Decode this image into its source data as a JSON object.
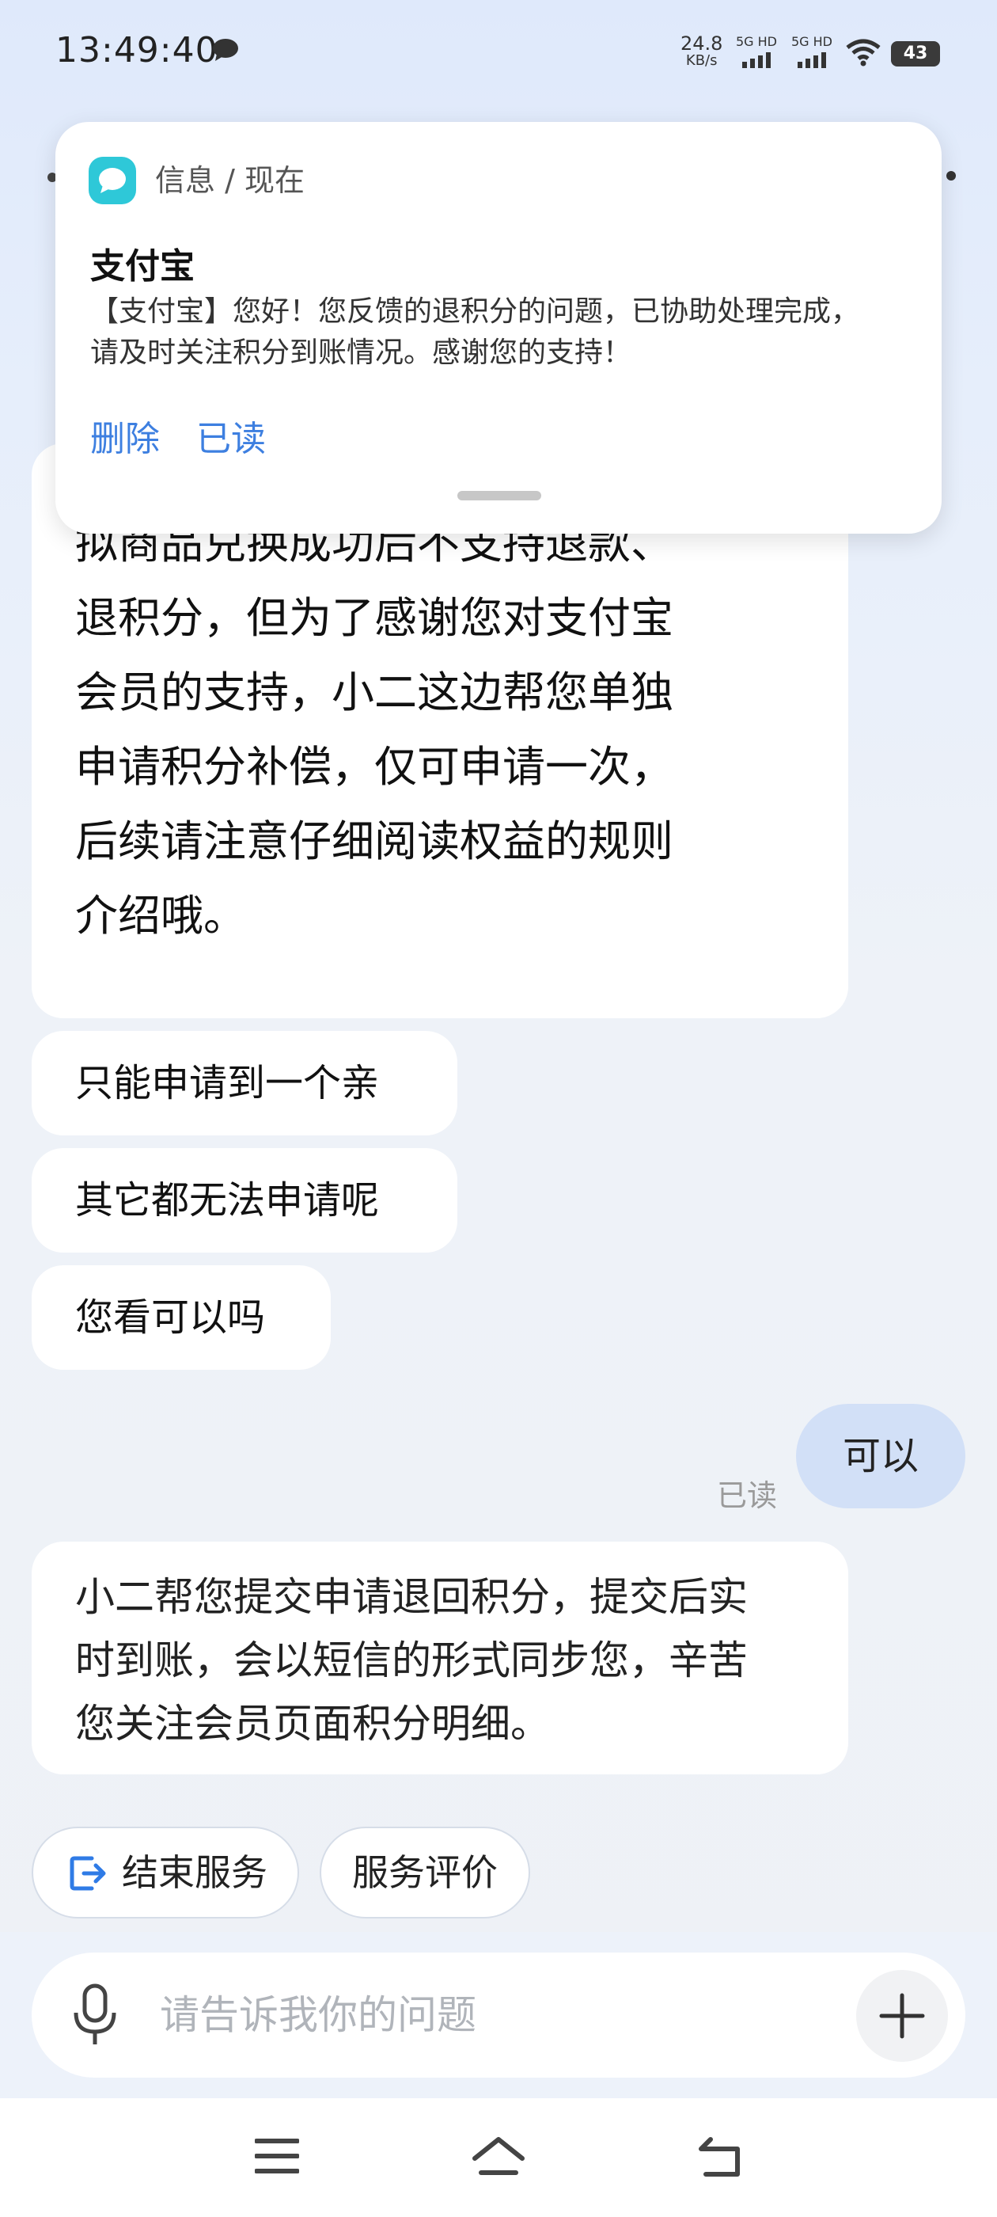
{
  "status_bar": {
    "time": "13:49:40",
    "net_speed_value": "24.8",
    "net_speed_unit": "KB/s",
    "sim1_label": "5G HD",
    "sim2_label": "5G HD",
    "battery": "43"
  },
  "notification": {
    "app_source": "信息 / 现在",
    "title": "支付宝",
    "body": "【支付宝】您好！您反馈的退积分的问题，已协助处理完成，\n请及时关注积分到账情况。感谢您的支持！",
    "actions": [
      "删除",
      "已读"
    ]
  },
  "chat": {
    "agent_long_message": "拟商品兑换成功后不支持退款、\n退积分，但为了感谢您对支付宝\n会员的支持，小二这边帮您单独\n申请积分补偿，仅可申请一次，\n后续请注意仔细阅读权益的规则\n介绍哦。",
    "agent_short_messages": [
      "只能申请到一个亲",
      "其它都无法申请呢",
      "您看可以吗"
    ],
    "user_message": "可以",
    "read_status": "已读",
    "agent_reply": "小二帮您提交申请退回积分，提交后实\n时到账，会以短信的形式同步您，辛苦\n您关注会员页面积分明细。"
  },
  "quick_actions": {
    "end_service": "结束服务",
    "rate_service": "服务评价"
  },
  "input": {
    "placeholder": "请告诉我你的问题"
  },
  "colors": {
    "accent": "#3d7fe0",
    "user_bubble": "#d2e0f7",
    "app_icon": "#2ec8d8"
  }
}
